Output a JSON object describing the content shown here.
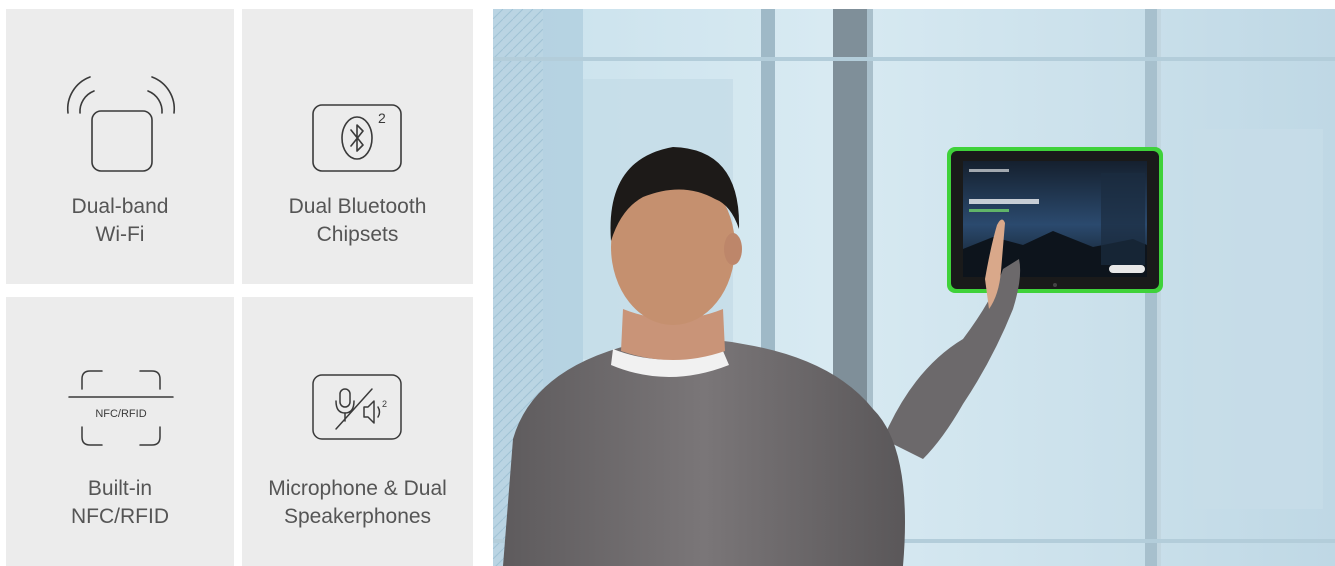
{
  "features": [
    {
      "line1": "Dual-band",
      "line2": "Wi-Fi",
      "icon": "wifi-icon"
    },
    {
      "line1": "Dual Bluetooth",
      "line2": "Chipsets",
      "icon": "bluetooth-icon",
      "superscript": "2"
    },
    {
      "line1": "Built-in",
      "line2": "NFC/RFID",
      "icon": "nfc-icon",
      "icon_text": "NFC/RFID"
    },
    {
      "line1": "Microphone & Dual",
      "line2": "Speakerphones",
      "icon": "mic-speaker-icon",
      "superscript": "2"
    }
  ],
  "colors": {
    "tile_bg": "#ececec",
    "text": "#555555",
    "icon_stroke": "#3a3a3a",
    "led_green": "#3fd23a",
    "glass": "#cfe4ee"
  }
}
